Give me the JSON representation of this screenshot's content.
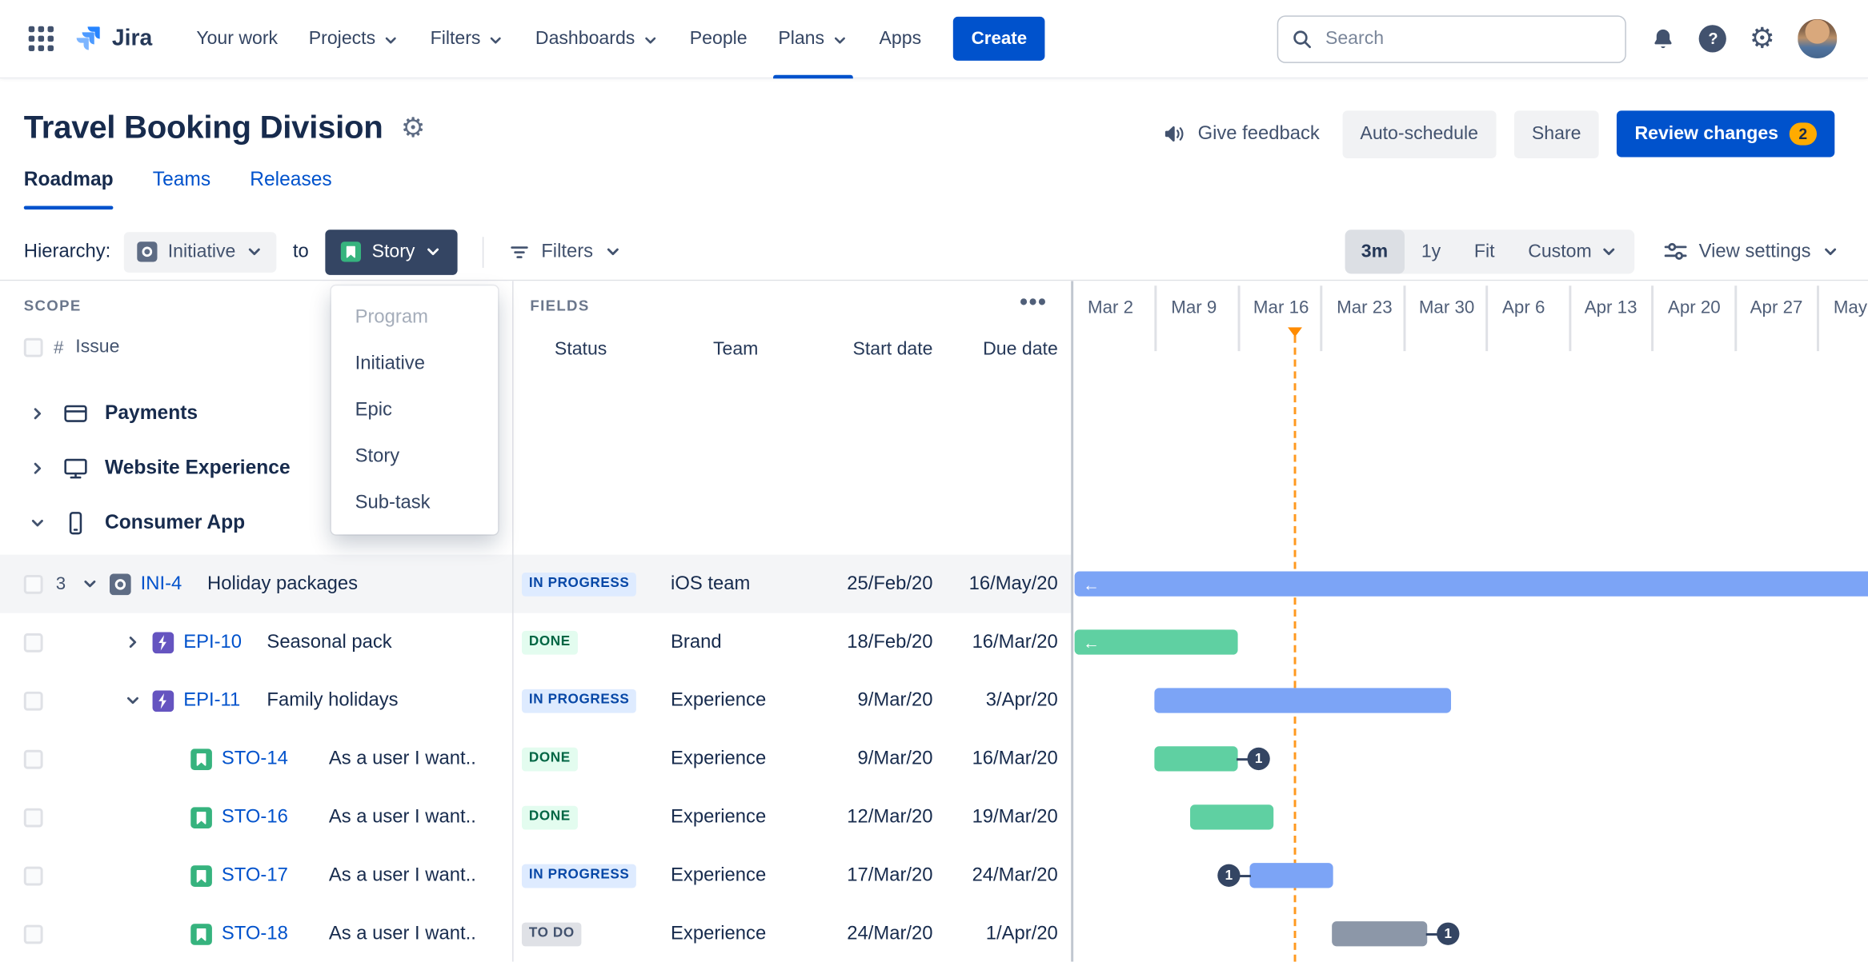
{
  "navbar": {
    "logo_text": "Jira",
    "items": [
      {
        "label": "Your work",
        "chevron": false
      },
      {
        "label": "Projects",
        "chevron": true
      },
      {
        "label": "Filters",
        "chevron": true
      },
      {
        "label": "Dashboards",
        "chevron": true
      },
      {
        "label": "People",
        "chevron": false
      },
      {
        "label": "Plans",
        "chevron": true,
        "active": true
      },
      {
        "label": "Apps",
        "chevron": false
      }
    ],
    "create_label": "Create",
    "search_placeholder": "Search"
  },
  "plan_header": {
    "title": "Travel Booking Division",
    "give_feedback": "Give feedback",
    "auto_schedule": "Auto-schedule",
    "share": "Share",
    "review_changes": "Review changes",
    "review_badge": "2"
  },
  "tabs": {
    "roadmap": "Roadmap",
    "teams": "Teams",
    "releases": "Releases"
  },
  "toolbar": {
    "hierarchy_label": "Hierarchy:",
    "from_level": "Initiative",
    "to_word": "to",
    "to_level": "Story",
    "filters_label": "Filters",
    "zoom": {
      "m3": "3m",
      "y1": "1y",
      "fit": "Fit",
      "custom": "Custom"
    },
    "view_settings": "View settings"
  },
  "level_dropdown": {
    "items": [
      {
        "label": "Program",
        "disabled": true
      },
      {
        "label": "Initiative",
        "disabled": false
      },
      {
        "label": "Epic",
        "disabled": false
      },
      {
        "label": "Story",
        "disabled": false
      },
      {
        "label": "Sub-task",
        "disabled": false
      }
    ]
  },
  "scope": {
    "label": "SCOPE",
    "hash": "#",
    "issue": "Issue",
    "groups": [
      {
        "label": "Payments",
        "icon": "credit-card-icon",
        "expanded": false
      },
      {
        "label": "Website Experience",
        "icon": "monitor-icon",
        "expanded": false
      },
      {
        "label": "Consumer App",
        "icon": "mobile-icon",
        "expanded": true
      }
    ]
  },
  "fields": {
    "label": "FIELDS",
    "columns": {
      "status": "Status",
      "team": "Team",
      "start": "Start date",
      "due": "Due date"
    }
  },
  "timeline": {
    "months": [
      "Mar 2",
      "Mar 9",
      "Mar 16",
      "Mar 23",
      "Mar 30",
      "Apr 6",
      "Apr 13",
      "Apr 20",
      "Apr 27",
      "May"
    ],
    "today_line_color": "#FF991F"
  },
  "rows": [
    {
      "count": "3",
      "expand": "down",
      "type": "initiative",
      "key": "INI-4",
      "summary": "Holiday packages",
      "status": "IN PROGRESS",
      "status_kind": "inprogress",
      "team": "iOS team",
      "start": "25/Feb/20",
      "due": "16/May/20",
      "bar": {
        "color": "blue",
        "arrow": "←"
      }
    },
    {
      "expand": "right",
      "type": "epic",
      "key": "EPI-10",
      "summary": "Seasonal pack",
      "status": "DONE",
      "status_kind": "done",
      "team": "Brand",
      "start": "18/Feb/20",
      "due": "16/Mar/20",
      "bar": {
        "color": "green",
        "arrow": "←"
      }
    },
    {
      "expand": "down",
      "type": "epic",
      "key": "EPI-11",
      "summary": "Family holidays",
      "status": "IN PROGRESS",
      "status_kind": "inprogress",
      "team": "Experience",
      "start": "9/Mar/20",
      "due": "3/Apr/20",
      "bar": {
        "color": "blue"
      }
    },
    {
      "type": "story",
      "key": "STO-14",
      "summary": "As a user I want..",
      "status": "DONE",
      "status_kind": "done",
      "team": "Experience",
      "start": "9/Mar/20",
      "due": "16/Mar/20",
      "bar": {
        "color": "green",
        "badge": "1",
        "badge_side": "right"
      }
    },
    {
      "type": "story",
      "key": "STO-16",
      "summary": "As a user I want..",
      "status": "DONE",
      "status_kind": "done",
      "team": "Experience",
      "start": "12/Mar/20",
      "due": "19/Mar/20",
      "bar": {
        "color": "green"
      }
    },
    {
      "type": "story",
      "key": "STO-17",
      "summary": "As a user I want..",
      "status": "IN PROGRESS",
      "status_kind": "inprogress",
      "team": "Experience",
      "start": "17/Mar/20",
      "due": "24/Mar/20",
      "bar": {
        "color": "blue",
        "badge": "1",
        "badge_side": "left"
      }
    },
    {
      "type": "story",
      "key": "STO-18",
      "summary": "As a user I want..",
      "status": "TO DO",
      "status_kind": "todo",
      "team": "Experience",
      "start": "24/Mar/20",
      "due": "1/Apr/20",
      "bar": {
        "color": "gray",
        "badge": "1",
        "badge_side": "right"
      }
    }
  ],
  "icons": {
    "gear": "⚙",
    "help_mark": "?",
    "more": "•••"
  },
  "colors": {
    "brand": "#0052CC",
    "bar_blue": "#7CA4F6",
    "bar_green": "#5FD0A2",
    "bar_gray": "#8C97A8",
    "today": "#FF991F",
    "badge": "#FFAB00"
  }
}
